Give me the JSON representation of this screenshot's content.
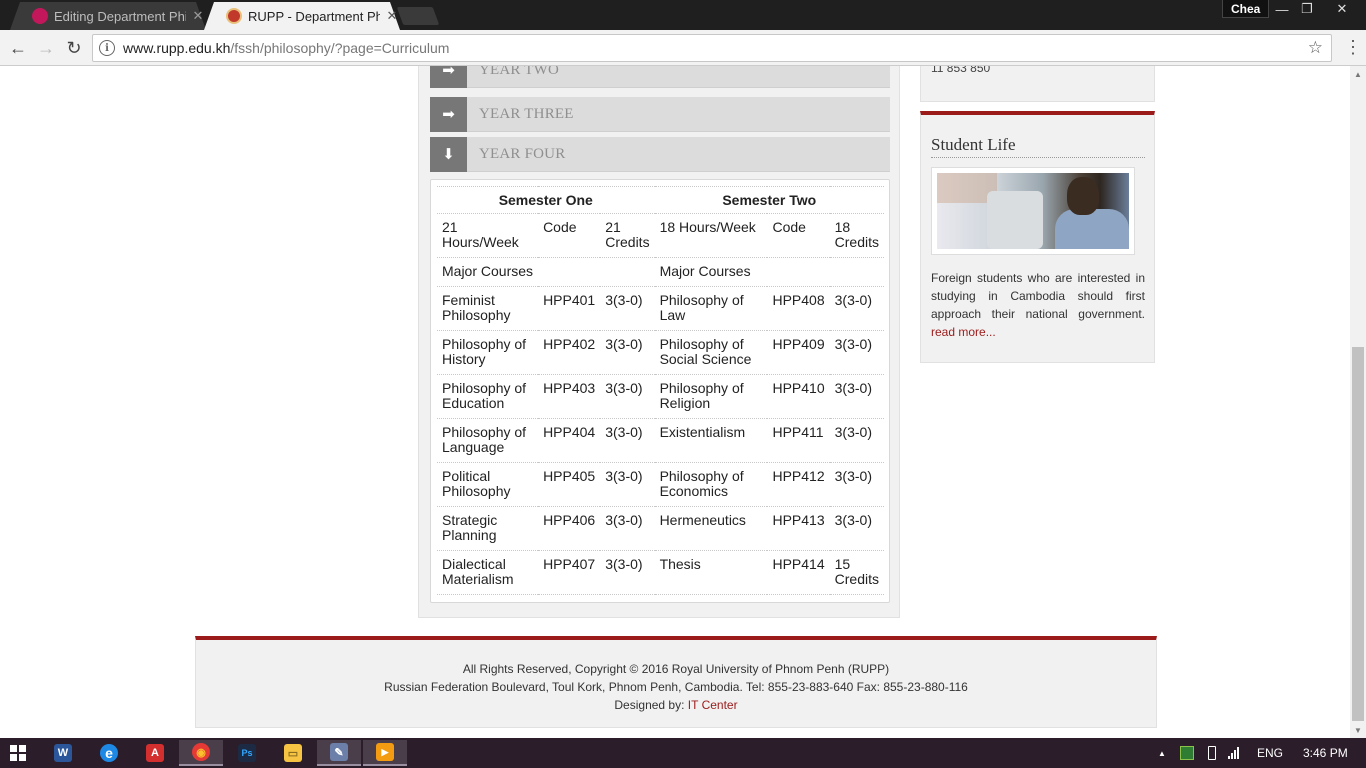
{
  "browser": {
    "tabs": [
      {
        "title": "Editing Department Philo",
        "favicon_color": "#c2185b",
        "close": "✕"
      },
      {
        "title": "RUPP - Department Philo",
        "favicon_color": "#c0392b",
        "close": "✕"
      }
    ],
    "user": "Chea",
    "window_buttons": {
      "minimize": "—",
      "restore": "❐",
      "close": "✕"
    },
    "nav": {
      "back": "←",
      "forward": "→",
      "reload": "↻"
    },
    "url_host": "www.rupp.edu.kh",
    "url_path": "/fssh/philosophy/?page=Curriculum",
    "info_icon": "i",
    "star_icon": "☆",
    "menu_icon": "⋮"
  },
  "years": [
    {
      "label": "YEAR TWO",
      "icon": "➡"
    },
    {
      "label": "YEAR THREE",
      "icon": "➡"
    },
    {
      "label": "YEAR FOUR",
      "icon": "⬇"
    }
  ],
  "curriculum": {
    "semester_one": "Semester One",
    "semester_two": "Semester Two",
    "hours_row": {
      "s1_hours": "21 Hours/Week",
      "s1_code": "Code",
      "s1_credits": "21 Credits",
      "s2_hours": "18 Hours/Week",
      "s2_code": "Code",
      "s2_credits": "18 Credits"
    },
    "major_row": {
      "s1": "Major Courses",
      "s2": "Major Courses"
    },
    "rows": [
      {
        "c1": "Feminist Philosophy",
        "code1": "HPP401",
        "cr1": "3(3-0)",
        "c2": "Philosophy of Law",
        "code2": "HPP408",
        "cr2": "3(3-0)"
      },
      {
        "c1": "Philosophy of History",
        "code1": "HPP402",
        "cr1": "3(3-0)",
        "c2": "Philosophy of Social Science",
        "code2": "HPP409",
        "cr2": "3(3-0)"
      },
      {
        "c1": "Philosophy of Education",
        "code1": "HPP403",
        "cr1": "3(3-0)",
        "c2": "Philosophy of Religion",
        "code2": "HPP410",
        "cr2": "3(3-0)"
      },
      {
        "c1": "Philosophy of Language",
        "code1": "HPP404",
        "cr1": "3(3-0)",
        "c2": "Existentialism",
        "code2": "HPP411",
        "cr2": "3(3-0)"
      },
      {
        "c1": "Political Philosophy",
        "code1": "HPP405",
        "cr1": "3(3-0)",
        "c2": "Philosophy of Economics",
        "code2": "HPP412",
        "cr2": "3(3-0)"
      },
      {
        "c1": "Strategic Planning",
        "code1": "HPP406",
        "cr1": "3(3-0)",
        "c2": "Hermeneutics",
        "code2": "HPP413",
        "cr2": "3(3-0)"
      },
      {
        "c1": "Dialectical Materialism",
        "code1": "HPP407",
        "cr1": "3(3-0)",
        "c2": "Thesis",
        "code2": "HPP414",
        "cr2": "15 Credits"
      }
    ]
  },
  "sidebar": {
    "contact_fragment": "11 853 850",
    "student_life": {
      "heading": "Student Life",
      "text": "Foreign students who are interested in studying in Cambodia should first approach their national government.",
      "read_more": "read more..."
    }
  },
  "footer": {
    "line1": "All Rights Reserved, Copyright © 2016 Royal University of Phnom Penh (RUPP)",
    "line2": "Russian Federation Boulevard, Toul Kork, Phnom Penh, Cambodia. Tel: 855-23-883-640 Fax: 855-23-880-116",
    "designed_by": "Designed by:",
    "designer": "IT Center"
  },
  "taskbar": {
    "apps": [
      {
        "name": "word",
        "glyph": "W",
        "color": "#2b579a"
      },
      {
        "name": "internet-explorer",
        "glyph": "e",
        "color": "#1e88e5"
      },
      {
        "name": "pdf-reader",
        "glyph": "A",
        "color": "#d32f2f"
      },
      {
        "name": "chrome",
        "glyph": "◉",
        "color": "#e53935"
      },
      {
        "name": "photoshop",
        "glyph": "Ps",
        "color": "#1c2a44"
      },
      {
        "name": "file-explorer",
        "glyph": "▭",
        "color": "#f6c342"
      },
      {
        "name": "paint",
        "glyph": "✎",
        "color": "#6b7fa8"
      },
      {
        "name": "media-player",
        "glyph": "▶",
        "color": "#f39c12"
      }
    ],
    "language": "ENG",
    "time": "3:46 PM",
    "tray_arrow": "▲"
  }
}
